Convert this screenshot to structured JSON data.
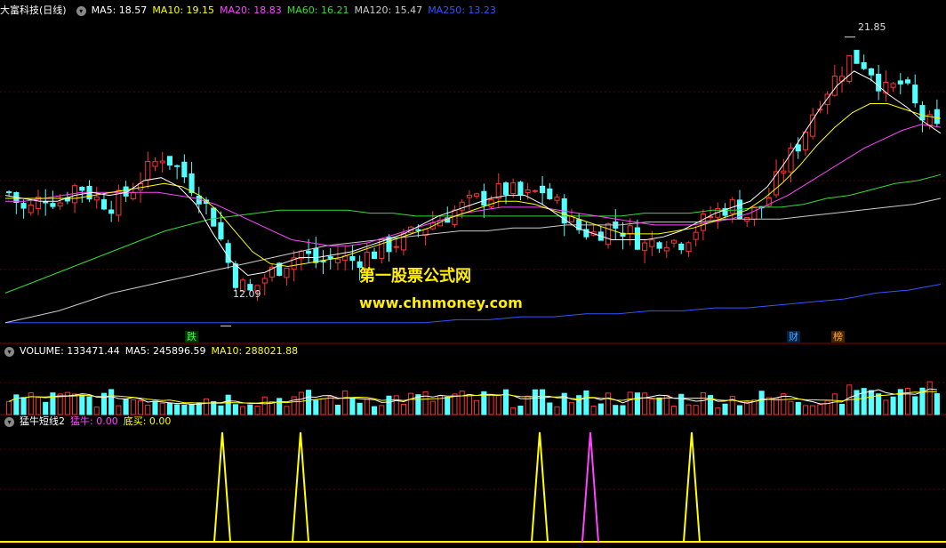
{
  "header": {
    "stock": "大富科技(日线)",
    "ma": [
      {
        "label": "MA5: 18.57",
        "color": "#ffffff"
      },
      {
        "label": "MA10: 19.15",
        "color": "#ffff00"
      },
      {
        "label": "MA20: 18.83",
        "color": "#ff44ff"
      },
      {
        "label": "MA60: 16.21",
        "color": "#33dd33"
      },
      {
        "label": "MA120: 15.47",
        "color": "#cccccc"
      },
      {
        "label": "MA250: 13.23",
        "color": "#3355ff"
      }
    ]
  },
  "volume_header": {
    "title": "VOLUME: 133471.44",
    "ma5": "MA5: 245896.59",
    "ma10": "MA10: 288021.88"
  },
  "indicator_header": {
    "title": "猛牛短线2",
    "mengniu": "猛牛: 0.00",
    "dimai": "底买: 0.00"
  },
  "annotations": {
    "high": "21.85",
    "low": "12.09",
    "badge_die": "跌",
    "badge_cai": "财",
    "badge_bang": "榜"
  },
  "watermark": {
    "line1": "第一股票公式网",
    "line2": "www.chnmoney.com"
  },
  "colors": {
    "up": "#ff3232",
    "down": "#54ffff",
    "ma5": "#ffffff",
    "ma10": "#ffff00",
    "ma20": "#ff44ff",
    "ma60": "#33dd33",
    "ma120": "#cccccc",
    "ma250": "#3355ff",
    "grid": "#8b0000",
    "mengniu": "#ff44ff",
    "dimai": "#ffff00"
  },
  "chart_data": [
    {
      "type": "candlestick",
      "title": "大富科技(日线)",
      "ylim": [
        11.5,
        22.5
      ],
      "grid": true,
      "close_path": [
        16.6,
        15.9,
        16.5,
        16.3,
        16.9,
        16.4,
        16.2,
        16.6,
        17.3,
        17.9,
        17.3,
        16.6,
        15.6,
        13.8,
        13.2,
        13.8,
        14.2,
        14.6,
        14.2,
        14.4,
        14.3,
        14.5,
        14.8,
        15.0,
        15.4,
        15.7,
        16.0,
        16.3,
        16.5,
        16.7,
        16.4,
        16.7,
        16.1,
        15.4,
        15.2,
        15.5,
        15.3,
        14.8,
        15.1,
        14.9,
        15.4,
        15.9,
        16.2,
        15.8,
        16.2,
        17.4,
        18.3,
        19.6,
        20.4,
        21.2,
        20.9,
        20.0,
        20.3,
        19.2,
        18.7
      ],
      "ma5_path": [
        16.5,
        16.4,
        16.3,
        16.3,
        16.5,
        16.6,
        16.5,
        16.6,
        17.0,
        17.1,
        16.8,
        16.2,
        15.2,
        14.3,
        13.8,
        13.9,
        14.2,
        14.4,
        14.4,
        14.5,
        14.6,
        14.8,
        15.0,
        15.2,
        15.5,
        15.8,
        16.0,
        16.2,
        16.4,
        16.5,
        16.5,
        16.2,
        15.8,
        15.4,
        15.2,
        15.0,
        15.0,
        15.0,
        15.1,
        15.3,
        15.6,
        15.9,
        16.1,
        16.3,
        16.8,
        17.6,
        18.5,
        19.4,
        20.2,
        20.7,
        20.4,
        19.9,
        19.5,
        19.0,
        18.6
      ],
      "ma10_path": [
        16.4,
        16.4,
        16.4,
        16.4,
        16.4,
        16.5,
        16.6,
        16.7,
        16.8,
        16.9,
        16.8,
        16.5,
        16.0,
        15.3,
        14.6,
        14.2,
        14.1,
        14.2,
        14.3,
        14.4,
        14.6,
        14.8,
        15.0,
        15.2,
        15.4,
        15.7,
        15.9,
        16.1,
        16.3,
        16.3,
        16.2,
        16.0,
        15.8,
        15.6,
        15.4,
        15.2,
        15.2,
        15.2,
        15.3,
        15.4,
        15.6,
        15.8,
        16.0,
        16.4,
        16.9,
        17.5,
        18.2,
        18.8,
        19.3,
        19.6,
        19.6,
        19.4,
        19.2,
        19.1
      ],
      "ma20_path": [
        16.3,
        16.3,
        16.4,
        16.5,
        16.6,
        16.6,
        16.6,
        16.6,
        16.6,
        16.5,
        16.4,
        16.2,
        15.9,
        15.6,
        15.3,
        15.0,
        14.9,
        14.8,
        14.8,
        14.9,
        15.1,
        15.3,
        15.5,
        15.7,
        15.9,
        16.0,
        16.1,
        16.1,
        16.1,
        16.0,
        15.9,
        15.8,
        15.7,
        15.6,
        15.5,
        15.5,
        15.5,
        15.6,
        15.7,
        15.9,
        16.2,
        16.5,
        16.9,
        17.3,
        17.7,
        18.1,
        18.4,
        18.7,
        18.9,
        18.8
      ],
      "ma60_path": [
        13.2,
        13.5,
        13.8,
        14.1,
        14.4,
        14.7,
        15.0,
        15.3,
        15.5,
        15.7,
        15.8,
        15.9,
        16.0,
        16.0,
        16.0,
        16.0,
        15.9,
        15.9,
        15.8,
        15.8,
        15.8,
        15.8,
        15.8,
        15.8,
        15.8,
        15.8,
        15.8,
        15.8,
        15.9,
        15.9,
        15.9,
        16.0,
        16.0,
        16.1,
        16.1,
        16.2,
        16.4,
        16.5,
        16.7,
        16.9,
        17.0,
        17.2
      ],
      "ma120_path": [
        12.2,
        12.4,
        12.6,
        12.9,
        13.2,
        13.4,
        13.6,
        13.8,
        14.0,
        14.2,
        14.4,
        14.6,
        14.8,
        14.9,
        15.0,
        15.1,
        15.2,
        15.3,
        15.3,
        15.4,
        15.4,
        15.5,
        15.5,
        15.5,
        15.6,
        15.6,
        15.6,
        15.7,
        15.7,
        15.7,
        15.8,
        15.9,
        16.0,
        16.1,
        16.2,
        16.4
      ],
      "ma250_path": [
        12.2,
        12.2,
        12.2,
        12.2,
        12.2,
        12.2,
        12.2,
        12.2,
        12.2,
        12.2,
        12.2,
        12.2,
        12.2,
        12.2,
        12.3,
        12.3,
        12.4,
        12.4,
        12.5,
        12.5,
        12.6,
        12.6,
        12.7,
        12.7,
        12.8,
        12.9,
        13.0,
        13.2,
        13.3,
        13.5
      ]
    },
    {
      "type": "bar",
      "title": "VOLUME",
      "ylim": [
        0,
        700000
      ],
      "ma5_value": 245896.59,
      "ma10_value": 288021.88,
      "last_volume": 133471.44
    },
    {
      "type": "line",
      "title": "猛牛短线2",
      "series": [
        {
          "name": "猛牛",
          "values": [
            0,
            0,
            0,
            0,
            1,
            0
          ]
        },
        {
          "name": "底买",
          "values": [
            0,
            1,
            1,
            1,
            0,
            1
          ]
        }
      ],
      "spike_positions": [
        250,
        338,
        607,
        664,
        778
      ]
    }
  ]
}
